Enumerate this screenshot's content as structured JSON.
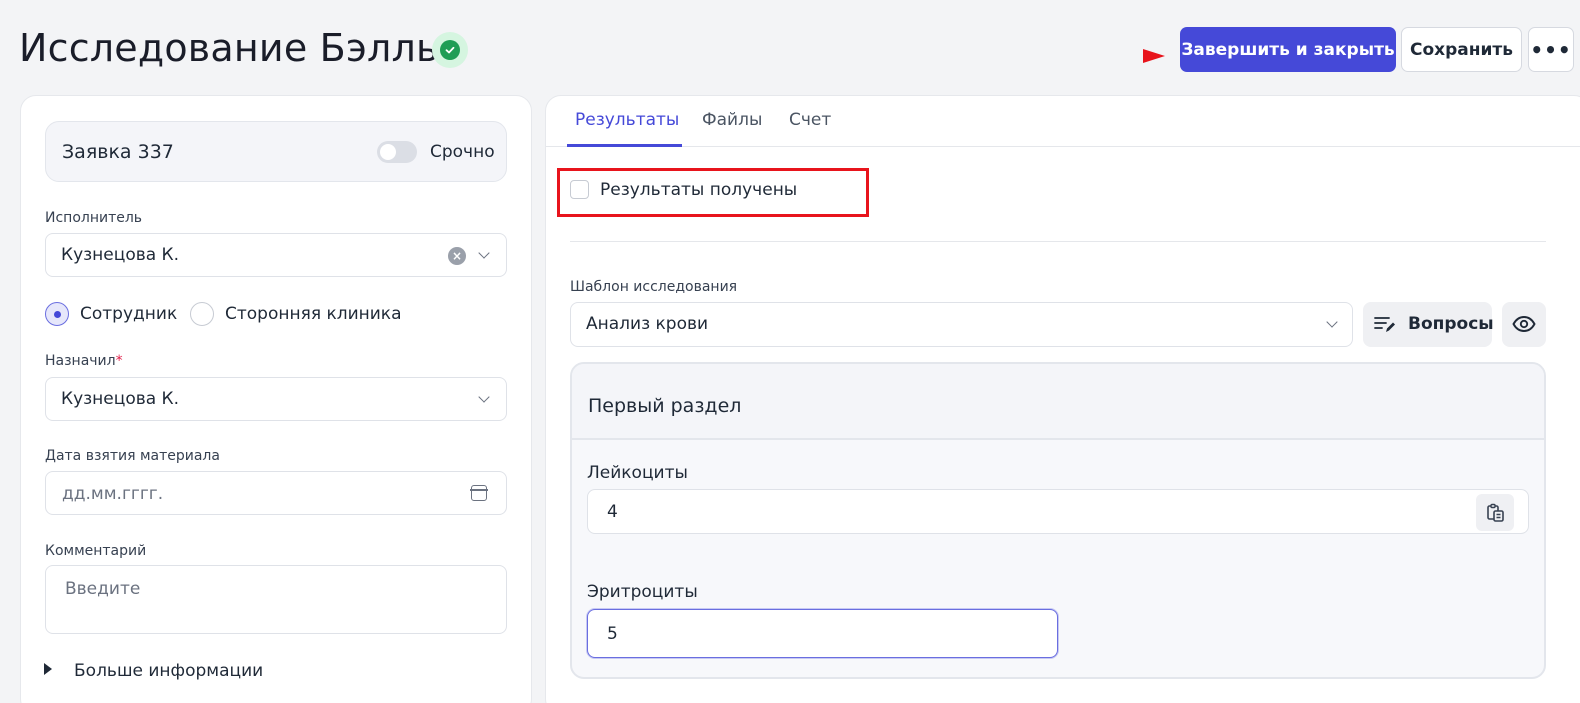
{
  "header": {
    "title": "Исследование Бэлль",
    "status_color": "#1f9d55",
    "primary_button": "Завершить и закрыть",
    "save_button": "Сохранить",
    "more_button": "•••"
  },
  "order": {
    "title": "Заявка 337",
    "urgent_label": "Срочно",
    "urgent_on": false
  },
  "form": {
    "executor_label": "Исполнитель",
    "executor_value": "Кузнецова К.",
    "radio_employee": "Сотрудник",
    "radio_external": "Сторонняя клиника",
    "assigned_label": "Назначил",
    "assigned_required": "*",
    "assigned_value": "Кузнецова К.",
    "date_label": "Дата взятия материала",
    "date_placeholder": "дд.мм.гггг.",
    "comment_label": "Комментарий",
    "comment_placeholder": "Введите",
    "more_info": "Больше информации"
  },
  "tabs": [
    "Результаты",
    "Файлы",
    "Счет"
  ],
  "results": {
    "received_label": "Результаты получены",
    "template_label": "Шаблон исследования",
    "template_value": "Анализ крови",
    "questions_button": "Вопросы",
    "section_title": "Первый раздел",
    "leukocytes_label": "Лейкоциты",
    "leukocytes_value": "4",
    "erythrocytes_label": "Эритроциты",
    "erythrocytes_value": "5"
  },
  "colors": {
    "accent": "#4549d8",
    "highlight": "#e8141c"
  }
}
